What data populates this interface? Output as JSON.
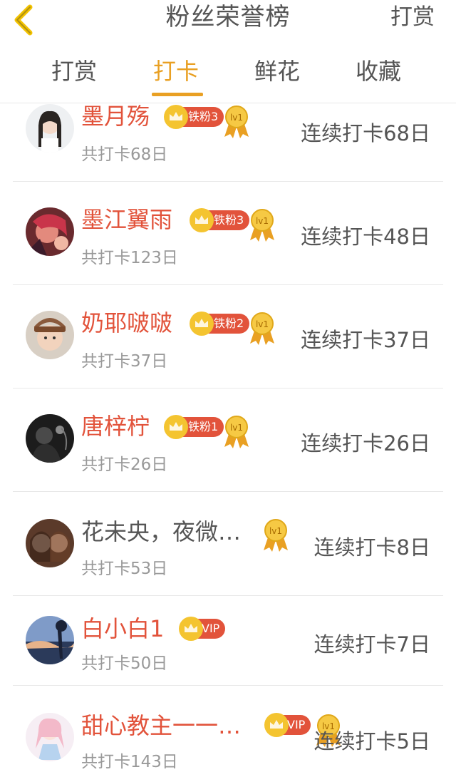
{
  "header": {
    "title": "粉丝荣誉榜",
    "action_label": "打赏"
  },
  "tabs": [
    {
      "label": "打赏"
    },
    {
      "label": "打卡"
    },
    {
      "label": "鲜花"
    },
    {
      "label": "收藏"
    }
  ],
  "active_tab": "打卡",
  "colors": {
    "accent": "#e9a023",
    "name_red": "#e2533b",
    "badge_red": "#e2533b",
    "crown_gold": "#f4c430"
  },
  "users": [
    {
      "name": "墨月殇",
      "badge": "铁粉3",
      "medal": "lv1",
      "total": "共打卡68日",
      "streak": "连续打卡68日"
    },
    {
      "name": "墨江翼雨",
      "badge": "铁粉3",
      "medal": "lv1",
      "total": "共打卡123日",
      "streak": "连续打卡48日"
    },
    {
      "name": "奶耶啵啵",
      "badge": "铁粉2",
      "medal": "lv1",
      "total": "共打卡37日",
      "streak": "连续打卡37日"
    },
    {
      "name": "唐梓柠",
      "badge": "铁粉1",
      "medal": "lv1",
      "total": "共打卡26日",
      "streak": "连续打卡26日"
    },
    {
      "name": "花未央，夜微…",
      "badge": "",
      "medal": "lv1",
      "total": "共打卡53日",
      "streak": "连续打卡8日"
    },
    {
      "name": "白小白1",
      "badge": "VIP",
      "medal": "",
      "total": "共打卡50日",
      "streak": "连续打卡7日"
    },
    {
      "name": "甜心教主一一…",
      "badge": "VIP",
      "medal": "lv1",
      "total": "共打卡143日",
      "streak": "连续打卡5日"
    }
  ]
}
